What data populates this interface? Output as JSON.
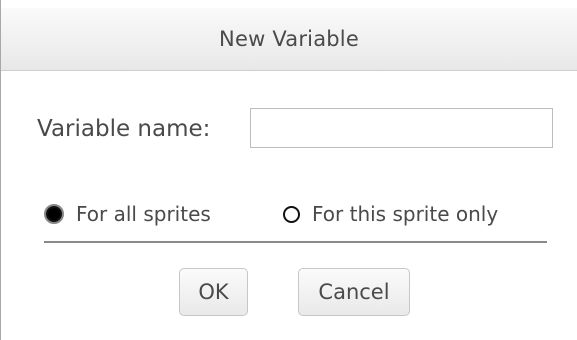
{
  "dialog": {
    "title": "New Variable",
    "name_label": "Variable name:",
    "name_value": "",
    "scope_options": [
      {
        "label": "For all sprites",
        "selected": true
      },
      {
        "label": "For this sprite only",
        "selected": false
      }
    ],
    "ok_label": "OK",
    "cancel_label": "Cancel"
  }
}
